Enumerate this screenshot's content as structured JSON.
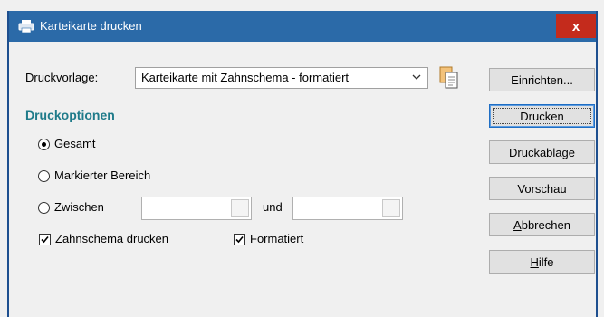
{
  "window": {
    "title": "Karteikarte drucken",
    "close_label": "x"
  },
  "template": {
    "label": "Druckvorlage:",
    "selected": "Karteikarte mit Zahnschema - formatiert"
  },
  "options": {
    "title": "Druckoptionen",
    "gesamt": "Gesamt",
    "markiert": "Markierter Bereich",
    "zwischen": "Zwischen",
    "und": "und",
    "from_value": "",
    "to_value": "",
    "zahnschema": "Zahnschema drucken",
    "formatiert": "Formatiert"
  },
  "buttons": {
    "einrichten": "Einrichten...",
    "drucken": "Drucken",
    "druckablage": "Druckablage",
    "vorschau": "Vorschau",
    "abbrechen_first": "A",
    "abbrechen_rest": "bbrechen",
    "hilfe_first": "H",
    "hilfe_rest": "ilfe"
  },
  "state": {
    "selected_range": "Gesamt",
    "zahnschema_checked": true,
    "formatiert_checked": true
  },
  "colors": {
    "titlebar": "#2b6aa8",
    "close": "#c42b1c",
    "section_title": "#1f7b8a"
  }
}
